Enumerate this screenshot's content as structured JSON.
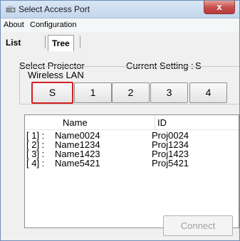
{
  "window": {
    "title": "Select Access Port",
    "close_label": "x"
  },
  "menu": {
    "items": [
      "About",
      "Configuration"
    ]
  },
  "tabs": [
    {
      "label": "List"
    },
    {
      "label": "Tree"
    }
  ],
  "select_projector_label": "Select Projector",
  "current_setting_label": "Current Setting :",
  "current_setting_value": "S",
  "wireless_lan_label": "Wireless LAN",
  "buttons": [
    "S",
    "1",
    "2",
    "3",
    "4"
  ],
  "selected_button": "S",
  "list": {
    "headers": {
      "name": "Name",
      "id": "ID"
    },
    "rows": [
      {
        "index": "[ 1] :",
        "name": "Name0024",
        "id": "Proj0024"
      },
      {
        "index": "[ 2] :",
        "name": "Name1234",
        "id": "Proj1234"
      },
      {
        "index": "[ 3] :",
        "name": "Name1423",
        "id": "Proj1423"
      },
      {
        "index": "[ 4] :",
        "name": "Name5421",
        "id": "Proj5421"
      }
    ]
  },
  "connect_label": "Connect",
  "colors": {
    "highlight": "#d32020",
    "disabled_text": "#a0a0a0"
  }
}
